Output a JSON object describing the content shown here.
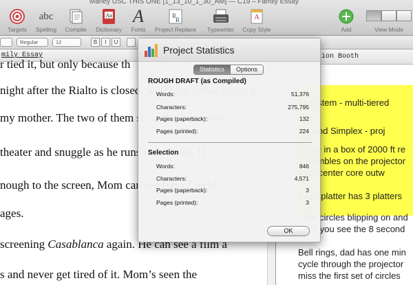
{
  "window": {
    "title": "Maney USC THIS ONE [1_13_10_1_30_AM] — C19 – Family Essay"
  },
  "toolbar": {
    "targets": {
      "label": "Targets",
      "icon": "target-icon"
    },
    "spelling": {
      "label": "Spelling",
      "icon_text": "abc"
    },
    "compile": {
      "label": "Compile",
      "icon": "compile-icon"
    },
    "dictionary": {
      "label": "Dictionary",
      "icon_text": "Aa"
    },
    "fonts": {
      "label": "Fonts",
      "icon_text": "A"
    },
    "project_replace": {
      "label": "Project Replace",
      "icon": "project-replace-icon"
    },
    "typewriter": {
      "label": "Typewriter",
      "icon": "typewriter-icon"
    },
    "copy_style": {
      "label": "Copy Style",
      "icon": "copy-style-icon"
    },
    "add": {
      "label": "Add",
      "icon": "plus-icon"
    },
    "view_mode": {
      "label": "View Mode"
    }
  },
  "format_bar": {
    "style": "Regular",
    "size": "12",
    "bold": "B",
    "italic": "I",
    "underline": "U"
  },
  "editor": {
    "header": "mily Essay",
    "lines": [
      "r tied it, but only because th",
      "night after the Rialto is closed, watching father plays a",
      "my mother. The two of them sit in the front row",
      "theater and snuggle as he runs the scenes. If",
      "nough to the screen, Mom can see bits of light",
      "ages.",
      "screening Casablanca again. He can see a film a",
      "s and never get tired of it. Mom’s seen the"
    ]
  },
  "right_pane": {
    "header": "Projection Booth",
    "lines": [
      "er system - multi-tiered",
      "ury and Simplex - proj",
      "Arrive in a box of 2000 ft re",
      "assembles on the projector",
      "from center core outw",
      "Each platter has 3 platters",
      "Little circles blipping on and",
      "once you see the 8 second",
      "Bell rings, dad has one min",
      "cycle through the projector",
      "miss the first set of circles"
    ]
  },
  "stats_panel": {
    "title": "Project Statistics",
    "tabs": [
      "Statistics",
      "Options"
    ],
    "active_tab": "Statistics",
    "draft": {
      "heading": "ROUGH DRAFT (as Compiled)",
      "rows": [
        {
          "label": "Words:",
          "value": "51,376"
        },
        {
          "label": "Characters:",
          "value": "275,795"
        },
        {
          "label": "Pages (paperback):",
          "value": "132"
        },
        {
          "label": "Pages (printed):",
          "value": "224"
        }
      ]
    },
    "selection": {
      "heading": "Selection",
      "rows": [
        {
          "label": "Words:",
          "value": "846"
        },
        {
          "label": "Characters:",
          "value": "4,571"
        },
        {
          "label": "Pages (paperback):",
          "value": "3"
        },
        {
          "label": "Pages (printed):",
          "value": "3"
        }
      ]
    },
    "ok_label": "OK"
  },
  "colors": {
    "highlight": "#ffff4d",
    "accent_blue": "#3a6fc4"
  }
}
